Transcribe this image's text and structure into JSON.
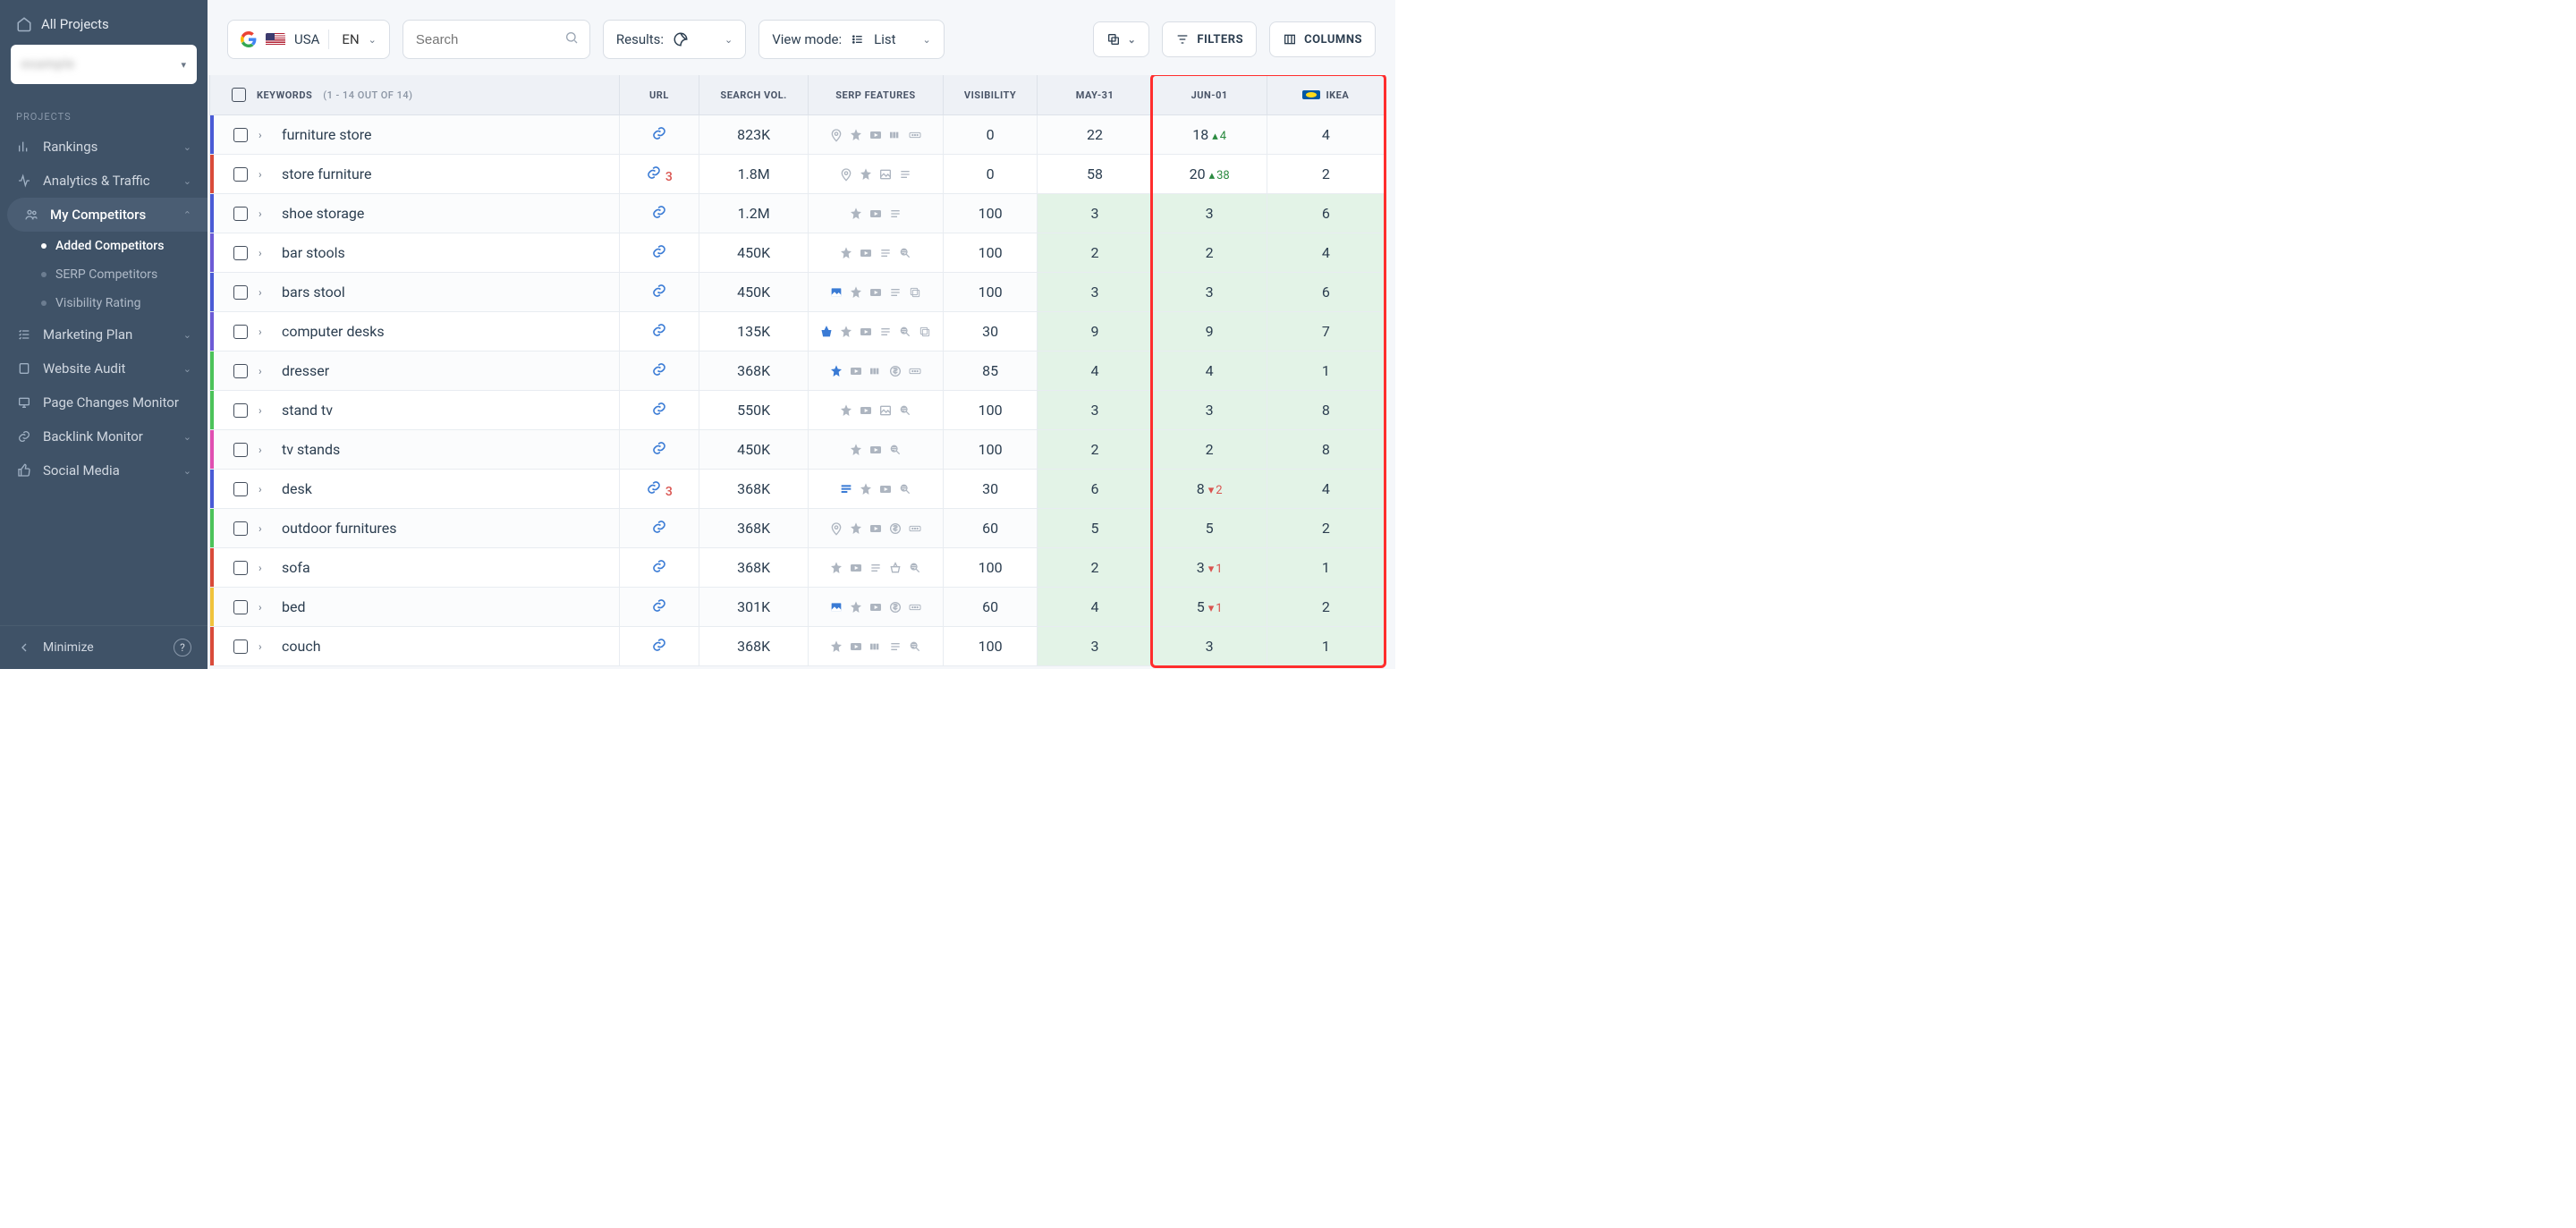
{
  "sidebar": {
    "all_projects": "All Projects",
    "project_name": "example",
    "section": "PROJECTS",
    "items": [
      {
        "label": "Rankings"
      },
      {
        "label": "Analytics & Traffic"
      },
      {
        "label": "My Competitors"
      },
      {
        "label": "Marketing Plan"
      },
      {
        "label": "Website Audit"
      },
      {
        "label": "Page Changes Monitor"
      },
      {
        "label": "Backlink Monitor"
      },
      {
        "label": "Social Media"
      }
    ],
    "sub_items": [
      {
        "label": "Added Competitors"
      },
      {
        "label": "SERP Competitors"
      },
      {
        "label": "Visibility Rating"
      }
    ],
    "minimize": "Minimize"
  },
  "toolbar": {
    "country": "USA",
    "lang": "EN",
    "search_placeholder": "Search",
    "results": "Results:",
    "viewmode_label": "View mode:",
    "viewmode_value": "List",
    "filters": "FILTERS",
    "columns": "COLUMNS"
  },
  "table": {
    "head": {
      "keywords": "KEYWORDS",
      "keywords_count": "(1 - 14 OUT OF 14)",
      "url": "URL",
      "vol": "SEARCH VOL.",
      "serp": "SERP FEATURES",
      "visibility": "VISIBILITY",
      "date1": "MAY-31",
      "date2": "JUN-01",
      "competitor": "IKEA"
    },
    "rows": [
      {
        "bar": "#4a5bd6",
        "keyword": "furniture store",
        "url_badge": "",
        "vol": "823K",
        "serp": [
          "pin",
          "star",
          "video",
          "carousel",
          "more"
        ],
        "vis": "0",
        "d1": {
          "v": "22"
        },
        "d2": {
          "v": "18",
          "delta": "4",
          "dir": "up"
        },
        "comp": "4"
      },
      {
        "bar": "#d94b3a",
        "keyword": "store furniture",
        "url_badge": "3",
        "vol": "1.8M",
        "serp": [
          "pin",
          "star",
          "image",
          "lines"
        ],
        "vis": "0",
        "d1": {
          "v": "58"
        },
        "d2": {
          "v": "20",
          "delta": "38",
          "dir": "up"
        },
        "comp": "2"
      },
      {
        "bar": "#4a5bd6",
        "keyword": "shoe storage",
        "url_badge": "",
        "vol": "1.2M",
        "serp": [
          "star",
          "video",
          "lines"
        ],
        "vis": "100",
        "d1": {
          "v": "3",
          "g": true
        },
        "d2": {
          "v": "3",
          "g": true
        },
        "comp": "6",
        "cg": true
      },
      {
        "bar": "#6d5bd6",
        "keyword": "bar stools",
        "url_badge": "",
        "vol": "450K",
        "serp": [
          "star",
          "video",
          "lines",
          "mag"
        ],
        "vis": "100",
        "d1": {
          "v": "2",
          "g": true
        },
        "d2": {
          "v": "2",
          "g": true
        },
        "comp": "4",
        "cg": true
      },
      {
        "bar": "#4a5bd6",
        "keyword": "bars stool",
        "url_badge": "",
        "vol": "450K",
        "serp": [
          "image-blue",
          "star",
          "video",
          "lines",
          "copy"
        ],
        "vis": "100",
        "d1": {
          "v": "3",
          "g": true
        },
        "d2": {
          "v": "3",
          "g": true
        },
        "comp": "6",
        "cg": true
      },
      {
        "bar": "#6d5bd6",
        "keyword": "computer desks",
        "url_badge": "",
        "vol": "135K",
        "serp": [
          "basket-blue",
          "star",
          "video",
          "lines",
          "mag",
          "copy"
        ],
        "vis": "30",
        "d1": {
          "v": "9",
          "g": true
        },
        "d2": {
          "v": "9",
          "g": true
        },
        "comp": "7",
        "cg": true
      },
      {
        "bar": "#4cc35a",
        "keyword": "dresser",
        "url_badge": "",
        "vol": "368K",
        "serp": [
          "star-blue",
          "video",
          "carousel",
          "dollar",
          "more"
        ],
        "vis": "85",
        "d1": {
          "v": "4",
          "g": true
        },
        "d2": {
          "v": "4",
          "g": true
        },
        "comp": "1",
        "cg": true
      },
      {
        "bar": "#4cc35a",
        "keyword": "stand tv",
        "url_badge": "",
        "vol": "550K",
        "serp": [
          "star",
          "video",
          "image",
          "mag"
        ],
        "vis": "100",
        "d1": {
          "v": "3",
          "g": true
        },
        "d2": {
          "v": "3",
          "g": true
        },
        "comp": "8",
        "cg": true
      },
      {
        "bar": "#e04fb1",
        "keyword": "tv stands",
        "url_badge": "",
        "vol": "450K",
        "serp": [
          "star",
          "video",
          "mag"
        ],
        "vis": "100",
        "d1": {
          "v": "2",
          "g": true
        },
        "d2": {
          "v": "2",
          "g": true
        },
        "comp": "8",
        "cg": true
      },
      {
        "bar": "#4a5bd6",
        "keyword": "desk",
        "url_badge": "3",
        "vol": "368K",
        "serp": [
          "featured-blue",
          "star",
          "video",
          "mag"
        ],
        "vis": "30",
        "d1": {
          "v": "6",
          "g": true
        },
        "d2": {
          "v": "8",
          "delta": "2",
          "dir": "down",
          "g": true
        },
        "comp": "4",
        "cg": true
      },
      {
        "bar": "#4cc35a",
        "keyword": "outdoor furnitures",
        "url_badge": "",
        "vol": "368K",
        "serp": [
          "pin",
          "star",
          "video",
          "dollar",
          "more"
        ],
        "vis": "60",
        "d1": {
          "v": "5",
          "g": true
        },
        "d2": {
          "v": "5",
          "g": true
        },
        "comp": "2",
        "cg": true
      },
      {
        "bar": "#d94b3a",
        "keyword": "sofa",
        "url_badge": "",
        "vol": "368K",
        "serp": [
          "star",
          "video",
          "lines",
          "basket",
          "mag"
        ],
        "vis": "100",
        "d1": {
          "v": "2",
          "g": true
        },
        "d2": {
          "v": "3",
          "delta": "1",
          "dir": "down",
          "g": true
        },
        "comp": "1",
        "cg": true
      },
      {
        "bar": "#f0c33c",
        "keyword": "bed",
        "url_badge": "",
        "vol": "301K",
        "serp": [
          "image-blue",
          "star",
          "video",
          "dollar",
          "more"
        ],
        "vis": "60",
        "d1": {
          "v": "4",
          "g": true
        },
        "d2": {
          "v": "5",
          "delta": "1",
          "dir": "down",
          "g": true
        },
        "comp": "2",
        "cg": true
      },
      {
        "bar": "#d94b3a",
        "keyword": "couch",
        "url_badge": "",
        "vol": "368K",
        "serp": [
          "star",
          "video",
          "carousel",
          "lines",
          "mag"
        ],
        "vis": "100",
        "d1": {
          "v": "3",
          "g": true
        },
        "d2": {
          "v": "3",
          "g": true
        },
        "comp": "1",
        "cg": true
      }
    ]
  }
}
